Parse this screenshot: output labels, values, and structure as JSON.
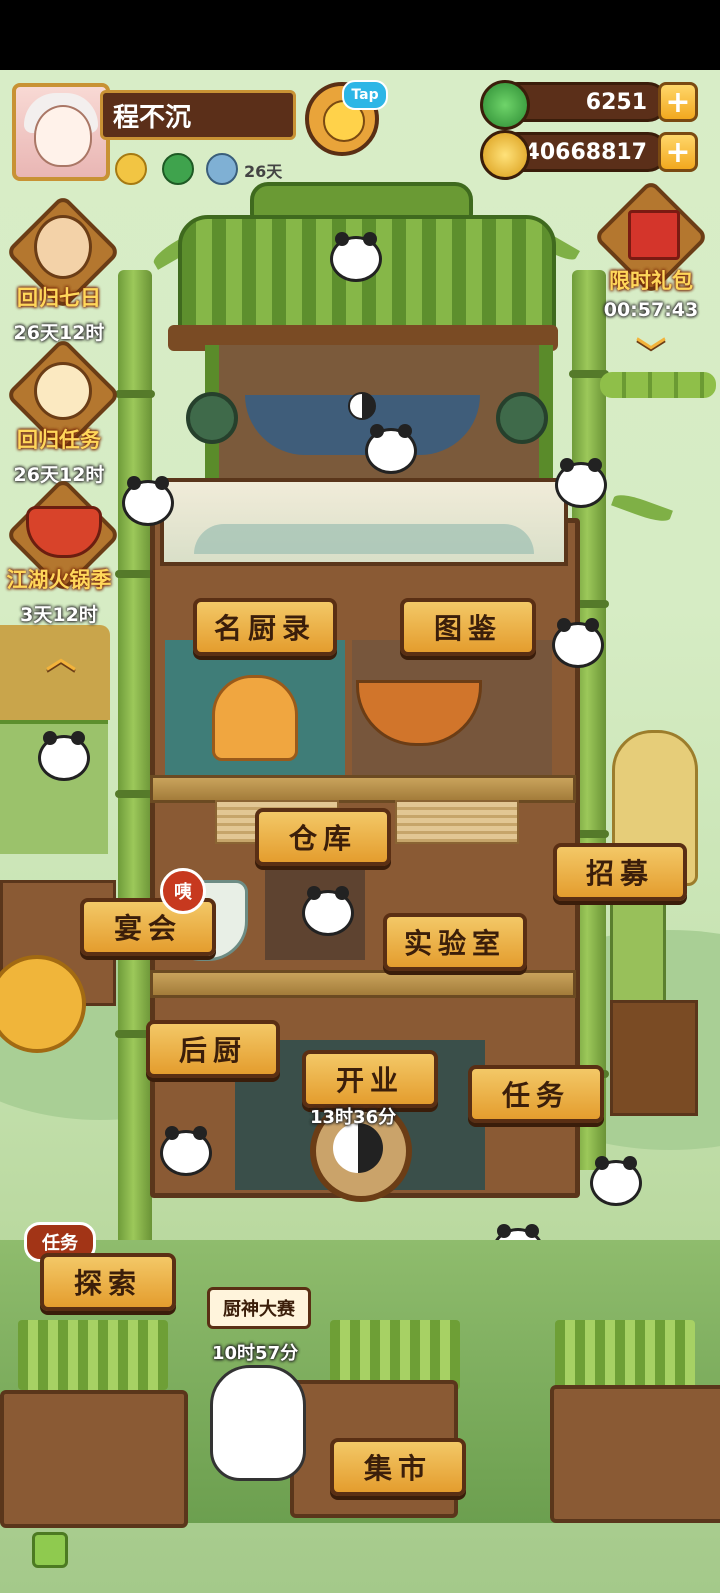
{
  "player": {
    "name": "程不沉",
    "days": "26天",
    "tap_label": "Tap"
  },
  "currency": {
    "jade": "6251",
    "coins": "40668817"
  },
  "events": [
    {
      "label": "回归七日",
      "timer": "26天12时"
    },
    {
      "label": "回归任务",
      "timer": "26天12时"
    },
    {
      "label": "江湖火锅季",
      "timer": "3天12时"
    }
  ],
  "gift": {
    "label": "限时礼包",
    "timer": "00:57:43"
  },
  "buildings": {
    "chefs": "名厨录",
    "handbook": "图鉴",
    "warehouse": "仓库",
    "recruit": "招募",
    "banquet": "宴会",
    "banquet_badge": "咦",
    "lab": "实验室",
    "kitchen": "后厨",
    "open": "开业",
    "open_timer": "13时36分",
    "tasks": "任务",
    "explore": "探索",
    "explore_badge": "任务",
    "contest": "厨神大赛",
    "contest_timer": "10时57分",
    "market": "集市"
  },
  "colors": {
    "sign_bg": "#e9a43a",
    "sign_border": "#5a2f14",
    "event_text": "#ffd75a",
    "badge_red": "#c7391f"
  },
  "icons": {
    "add": "plus-icon",
    "up": "chevron-up-icon",
    "down": "chevron-down-icon"
  }
}
